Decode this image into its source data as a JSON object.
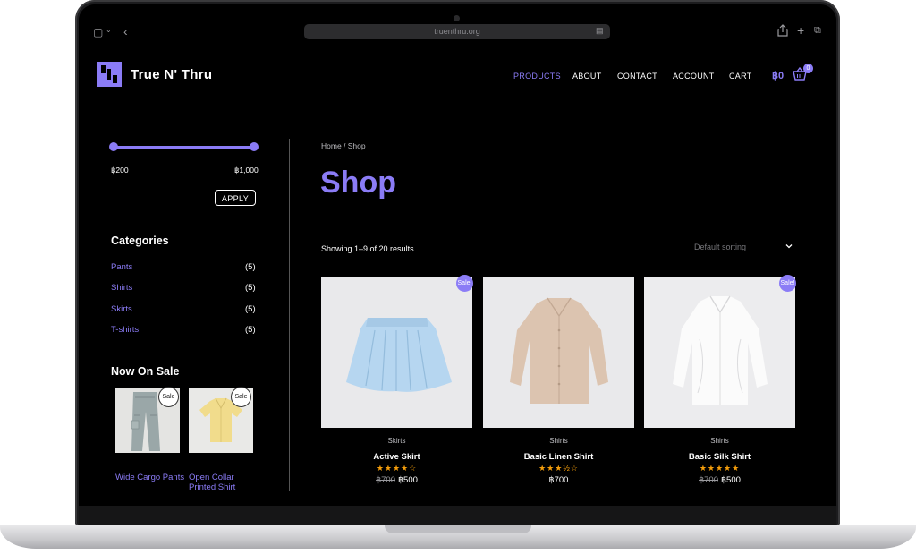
{
  "browser": {
    "url": "truenthru.org"
  },
  "header": {
    "site_title": "True N' Thru",
    "nav": [
      {
        "label": "PRODUCTS",
        "active": true
      },
      {
        "label": "ABOUT",
        "active": false
      },
      {
        "label": "CONTACT",
        "active": false
      },
      {
        "label": "ACCOUNT",
        "active": false
      },
      {
        "label": "CART",
        "active": false
      }
    ],
    "cart_total": "฿0",
    "cart_count": "0"
  },
  "sidebar": {
    "price_filter": {
      "min_label": "฿200",
      "max_label": "฿1,000",
      "apply_label": "APPLY"
    },
    "categories_heading": "Categories",
    "categories": [
      {
        "name": "Pants",
        "count": "(5)"
      },
      {
        "name": "Shirts",
        "count": "(5)"
      },
      {
        "name": "Skirts",
        "count": "(5)"
      },
      {
        "name": "T-shirts",
        "count": "(5)"
      }
    ],
    "on_sale_heading": "Now On Sale",
    "on_sale": [
      {
        "name": "Wide Cargo Pants",
        "badge": "Sale"
      },
      {
        "name": "Open Collar Printed Shirt",
        "badge": "Sale"
      }
    ]
  },
  "main": {
    "breadcrumb": "Home / Shop",
    "title": "Shop",
    "results": "Showing 1–9 of 20 results",
    "sort_label": "Default sorting",
    "products": [
      {
        "category": "Skirts",
        "name": "Active Skirt",
        "stars": "★★★★☆",
        "rating": 4,
        "old_price": "฿700",
        "price": "฿500",
        "badge": "Sale!"
      },
      {
        "category": "Shirts",
        "name": "Basic Linen Shirt",
        "stars": "★★★½☆",
        "rating": 3.5,
        "old_price": "",
        "price": "฿700",
        "badge": ""
      },
      {
        "category": "Shirts",
        "name": "Basic Silk Shirt",
        "stars": "★★★★★",
        "rating": 5,
        "old_price": "฿700",
        "price": "฿500",
        "badge": "Sale!"
      }
    ]
  },
  "colors": {
    "accent": "#8b7cf6",
    "background": "#000000",
    "star": "#f59e0b"
  }
}
